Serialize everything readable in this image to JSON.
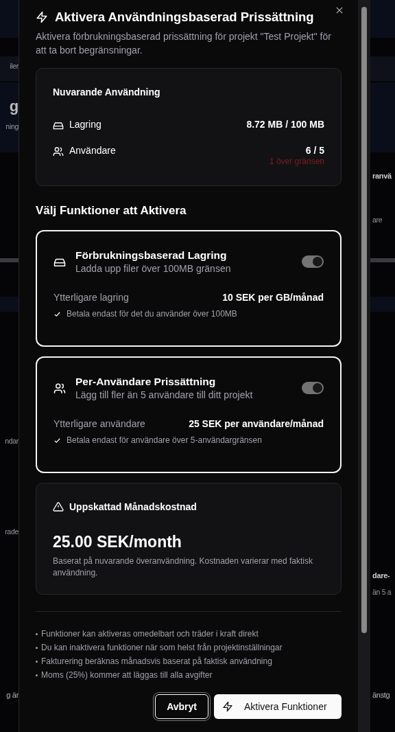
{
  "background": {
    "left": [
      {
        "text": "iler",
        "kind": "muted"
      },
      {
        "text": "g",
        "kind": "big"
      },
      {
        "text": "ning",
        "kind": "muted"
      },
      {
        "text": "ndar",
        "kind": "muted"
      },
      {
        "text": "rade",
        "kind": "muted"
      },
      {
        "text": "g är",
        "kind": "plain"
      }
    ],
    "right": [
      {
        "text": "ranvä",
        "kind": "bold"
      },
      {
        "text": "are",
        "kind": "muted"
      },
      {
        "text": "dare-",
        "kind": "bold"
      },
      {
        "text": "än 5 a",
        "kind": "muted"
      },
      {
        "text": "änstg",
        "kind": "plain"
      }
    ]
  },
  "dialog": {
    "title": "Aktivera Användningsbaserad Prissättning",
    "description": "Aktivera förbrukningsbaserad prissättning för projekt \"Test Projekt\" för att ta bort begränsningar.",
    "usage": {
      "title": "Nuvarande Användning",
      "rows": [
        {
          "kind": "storage",
          "label": "Lagring",
          "value": "8.72 MB / 100 MB"
        },
        {
          "kind": "users",
          "label": "Användare",
          "value": "6 / 5",
          "warning": "1 över gränsen"
        }
      ]
    },
    "features_heading": "Välj Funktioner att Aktivera",
    "features": [
      {
        "kind": "storage",
        "title": "Förbrukningsbaserad Lagring",
        "subtitle": "Ladda upp filer över 100MB gränsen",
        "on": true,
        "selected": true,
        "price_label": "Ytterligare lagring",
        "price": "10 SEK per GB/månad",
        "note": "Betala endast för det du använder över 100MB"
      },
      {
        "kind": "users",
        "title": "Per-Användare Prissättning",
        "subtitle": "Lägg till fler än 5 användare till ditt projekt",
        "on": true,
        "selected": true,
        "price_label": "Ytterligare användare",
        "price": "25 SEK per användare/månad",
        "note": "Betala endast för användare över 5-användargränsen"
      }
    ],
    "estimate": {
      "title": "Uppskattad Månadskostnad",
      "amount": "25.00 SEK/month",
      "note": "Baserat på nuvarande överanvändning. Kostnaden varierar med faktisk användning."
    },
    "notes": [
      "Funktioner kan aktiveras omedelbart och träder i kraft direkt",
      "Du kan inaktivera funktioner när som helst från projektinställningar",
      "Fakturering beräknas månadsvis baserat på faktisk användning",
      "Moms (25%) kommer att läggas till alla avgifter"
    ],
    "buttons": [
      {
        "kind": "cancel",
        "label": "Avbryt"
      },
      {
        "kind": "primary",
        "label": "Aktivera Funktioner"
      }
    ]
  }
}
